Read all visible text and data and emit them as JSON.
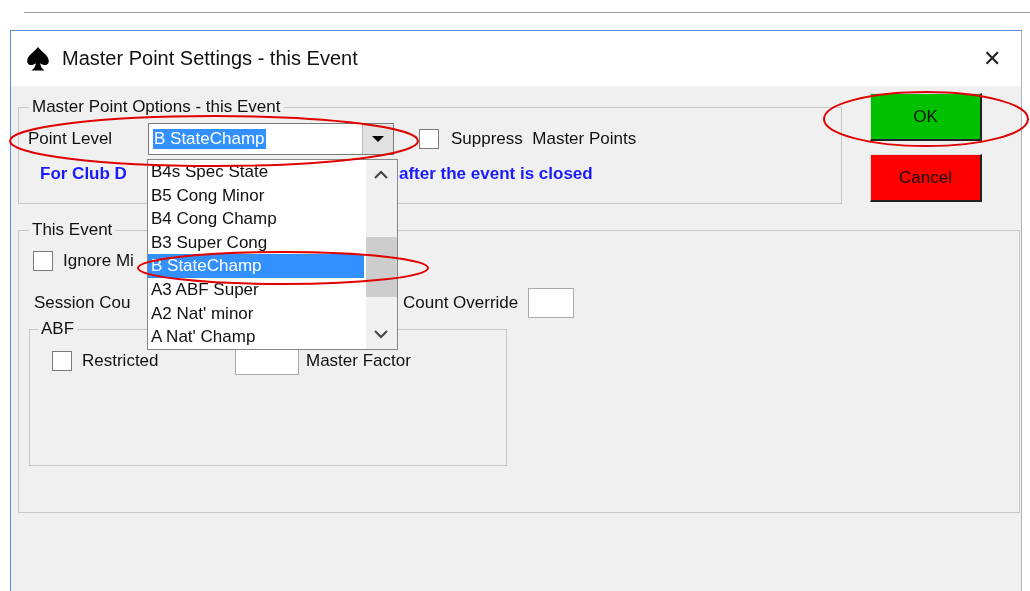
{
  "window": {
    "title": "Master Point Settings - this Event",
    "close": "✕"
  },
  "master_point_options": {
    "title": "Master Point Options - this Event",
    "point_level": {
      "label": "Point Level",
      "value": "B StateChamp",
      "expanded": true,
      "options": [
        {
          "label": "B4s Spec State",
          "selected": false
        },
        {
          "label": "B5 Cong Minor",
          "selected": false
        },
        {
          "label": "B4 Cong Champ",
          "selected": false
        },
        {
          "label": "B3 Super Cong",
          "selected": false
        },
        {
          "label": "B StateChamp",
          "selected": true
        },
        {
          "label": "A3 ABF Super",
          "selected": false
        },
        {
          "label": "A2 Nat' minor",
          "selected": false
        },
        {
          "label": "A Nat' Champ",
          "selected": false
        }
      ]
    },
    "suppress": {
      "label": "Suppress  Master Points",
      "checked": false
    },
    "note": [
      "For Club D",
      "after the event is closed"
    ]
  },
  "buttons": [
    {
      "label": "OK",
      "kind": "ok"
    },
    {
      "label": "Cancel",
      "kind": "cancel"
    }
  ],
  "this_event": {
    "title": "This Event",
    "ignore": {
      "label": "Ignore Mi",
      "checked": false
    },
    "session_count_label": "Session Cou",
    "count_override": {
      "label": "Count Override"
    },
    "abf": {
      "title": "ABF",
      "restricted": {
        "label": "Restricted",
        "checked": false
      },
      "master_factor": {
        "label": "Master Factor"
      }
    }
  }
}
